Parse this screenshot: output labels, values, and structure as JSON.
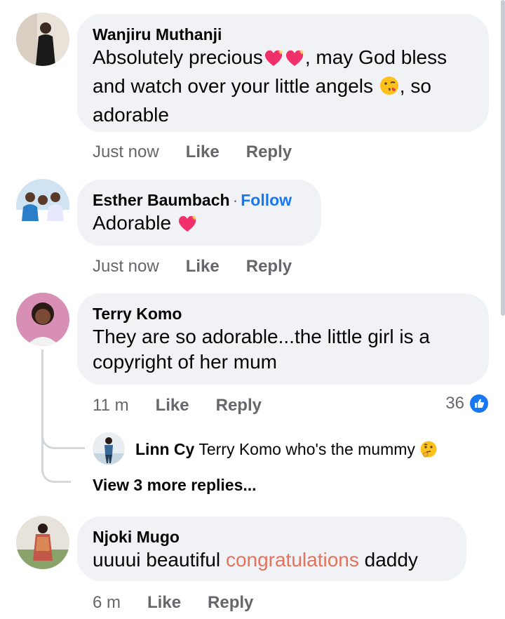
{
  "comments": [
    {
      "author": "Wanjiru Muthanji",
      "text_part1": "Absolutely precious",
      "text_part2": ", may God bless",
      "text_part3": "and watch over your little angels",
      "text_part4": ", so",
      "text_part5": "adorable",
      "time": "Just now",
      "like_label": "Like",
      "reply_label": "Reply",
      "avatar_icon": "avatar-photo-icon"
    },
    {
      "author": "Esther Baumbach",
      "separator": "·",
      "follow_label": "Follow",
      "text": "Adorable",
      "time": "Just now",
      "like_label": "Like",
      "reply_label": "Reply",
      "avatar_icon": "avatar-photo-icon"
    },
    {
      "author": "Terry Komo",
      "text_line1": "They are so adorable...the little girl is a",
      "text_line2": "copyright of her mum",
      "time": "11 m",
      "like_label": "Like",
      "reply_label": "Reply",
      "reaction_count": "36",
      "reaction_icon": "like-thumb-icon",
      "reply": {
        "author": "Linn Cy",
        "text": "Terry Komo who's the mummy"
      },
      "more_replies": "View 3 more replies..."
    },
    {
      "author": "Njoki Mugo",
      "text_before": "uuuui beautiful",
      "text_highlight": "congratulations",
      "text_after": "daddy",
      "time": "6 m",
      "like_label": "Like",
      "reply_label": "Reply",
      "avatar_icon": "avatar-photo-icon"
    }
  ],
  "colors": {
    "bubble": "#f0f2f5",
    "link_blue": "#1877f2",
    "meta_gray": "#65676b",
    "highlight": "#e4735d"
  }
}
